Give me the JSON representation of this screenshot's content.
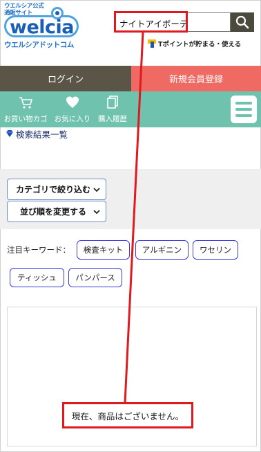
{
  "logo": {
    "small_line1": "ウエルシア公式",
    "small_line2": "通販サイト",
    "wordmark": "welcia",
    "subtitle": "ウエルシアドットコム"
  },
  "search": {
    "value": "ナイトアイボーテ",
    "button_icon": "search-icon"
  },
  "tpoint": {
    "text": "Tポイントが貯まる・使える"
  },
  "nav": {
    "login_label": "ログイン",
    "register_label": "新規会員登録"
  },
  "menu": {
    "cart_label": "お買い物カゴ",
    "favorites_label": "お気に入り",
    "history_label": "購入履歴",
    "hamburger_icon": "menu-icon"
  },
  "breadcrumb": {
    "label": "検索結果一覧"
  },
  "filters": {
    "category_label": "カテゴリで絞り込む",
    "sort_label": "並び順を変更する"
  },
  "keywords": {
    "label": "注目キーワード：",
    "tags": [
      "検査キット",
      "アルギニン",
      "ワセリン",
      "ティッシュ",
      "パンパース"
    ]
  },
  "results": {
    "empty_message": "現在、商品はございません。"
  },
  "colors": {
    "brand_blue": "#1a5fb4",
    "login_bg": "#5a5546",
    "register_bg": "#ee6a63",
    "menubar_bg": "#6fc2ad",
    "highlight_red": "#e0191e"
  }
}
